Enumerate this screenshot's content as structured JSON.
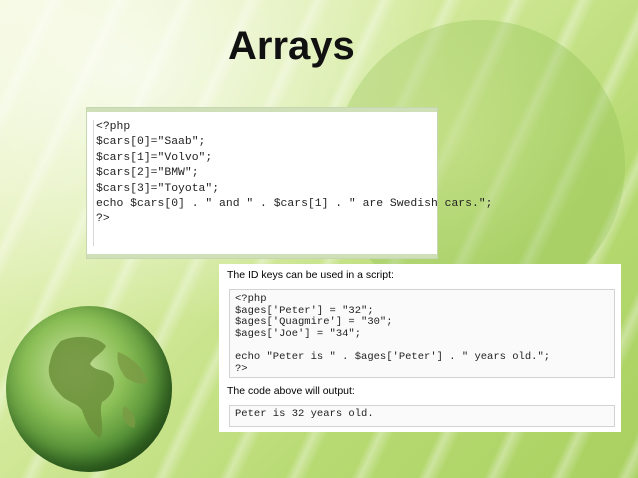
{
  "slide": {
    "title": "Arrays"
  },
  "code_block_1": {
    "lines": [
      "<?php",
      "$cars[0]=\"Saab\";",
      "$cars[1]=\"Volvo\";",
      "$cars[2]=\"BMW\";",
      "$cars[3]=\"Toyota\";",
      "echo $cars[0] . \" and \" . $cars[1] . \" are Swedish cars.\";",
      "?>"
    ]
  },
  "panel_2": {
    "heading_1": "The ID keys can be used in a script:",
    "code_lines": [
      "<?php",
      "$ages['Peter'] = \"32\";",
      "$ages['Quagmire'] = \"30\";",
      "$ages['Joe'] = \"34\";",
      "",
      "echo \"Peter is \" . $ages['Peter'] . \" years old.\";",
      "?>"
    ],
    "heading_2": "The code above will output:",
    "output_line": "Peter is 32 years old."
  }
}
